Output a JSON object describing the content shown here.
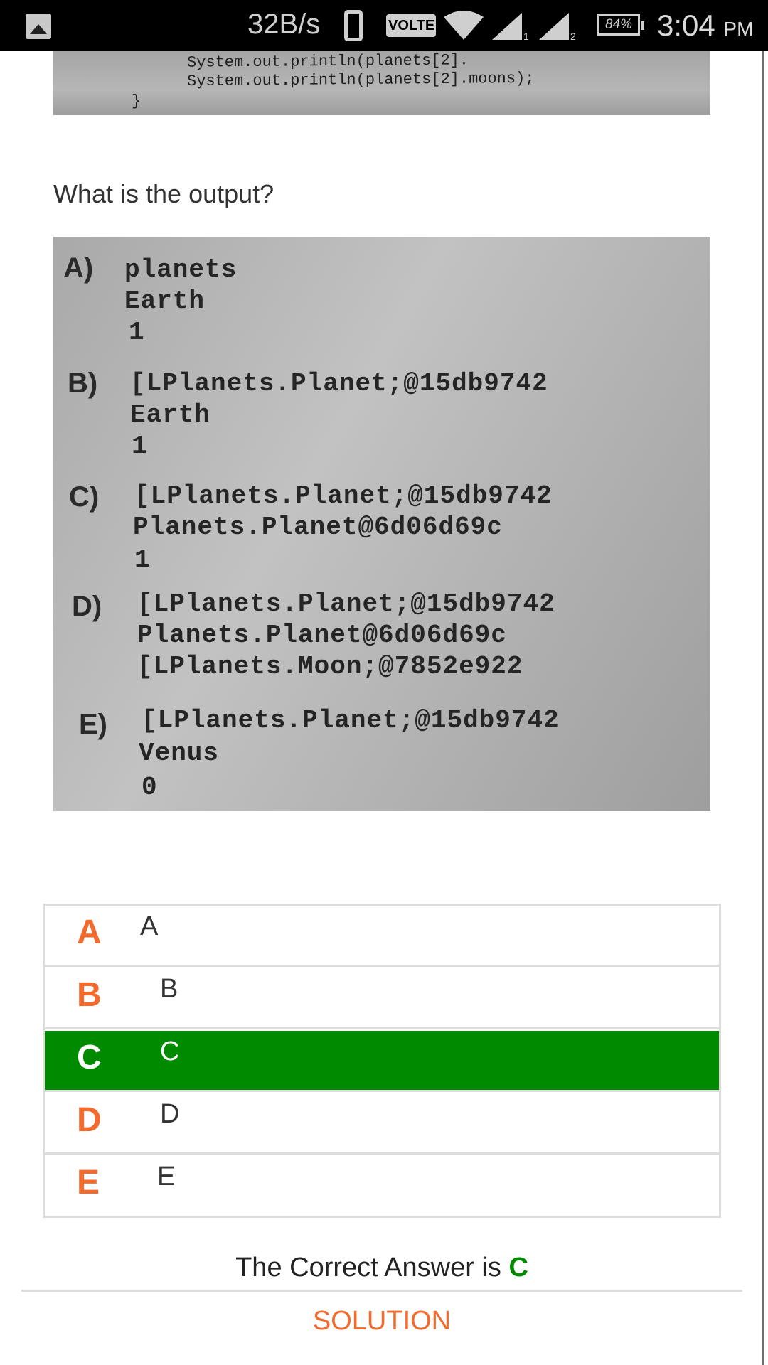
{
  "status_bar": {
    "speed": "32B/s",
    "volte": "VOLTE",
    "sim1": "1",
    "sim2": "2",
    "battery": "84%",
    "time": "3:04",
    "ampm": "PM",
    "icons": [
      "gallery-icon",
      "phone-icon",
      "wifi-icon",
      "signal-icon",
      "signal-icon",
      "battery-icon"
    ]
  },
  "code_image": {
    "lines": [
      "System.out.println(planets[2].",
      "System.out.println(planets[2].moons);",
      "}"
    ]
  },
  "question": "What is the output?",
  "answer_image": {
    "options": [
      {
        "letter": "A)",
        "lines": [
          "planets",
          "Earth",
          "1"
        ]
      },
      {
        "letter": "B)",
        "lines": [
          "[LPlanets.Planet;@15db9742",
          "Earth",
          "1"
        ]
      },
      {
        "letter": "C)",
        "lines": [
          "[LPlanets.Planet;@15db9742",
          "Planets.Planet@6d06d69c",
          "1"
        ]
      },
      {
        "letter": "D)",
        "lines": [
          "[LPlanets.Planet;@15db9742",
          "Planets.Planet@6d06d69c",
          "[LPlanets.Moon;@7852e922"
        ]
      },
      {
        "letter": "E)",
        "lines": [
          "[LPlanets.Planet;@15db9742",
          "Venus",
          "0"
        ]
      }
    ]
  },
  "choices": [
    {
      "letter": "A",
      "text": "A",
      "selected": false
    },
    {
      "letter": "B",
      "text": "B",
      "selected": false
    },
    {
      "letter": "C",
      "text": "C",
      "selected": true
    },
    {
      "letter": "D",
      "text": "D",
      "selected": false
    },
    {
      "letter": "E",
      "text": "E",
      "selected": false
    }
  ],
  "correct": {
    "prefix": "The Correct Answer is ",
    "answer": "C"
  },
  "solution_label": "SOLUTION",
  "colors": {
    "accent_orange": "#f26a2c",
    "selected_green": "#008a00"
  }
}
